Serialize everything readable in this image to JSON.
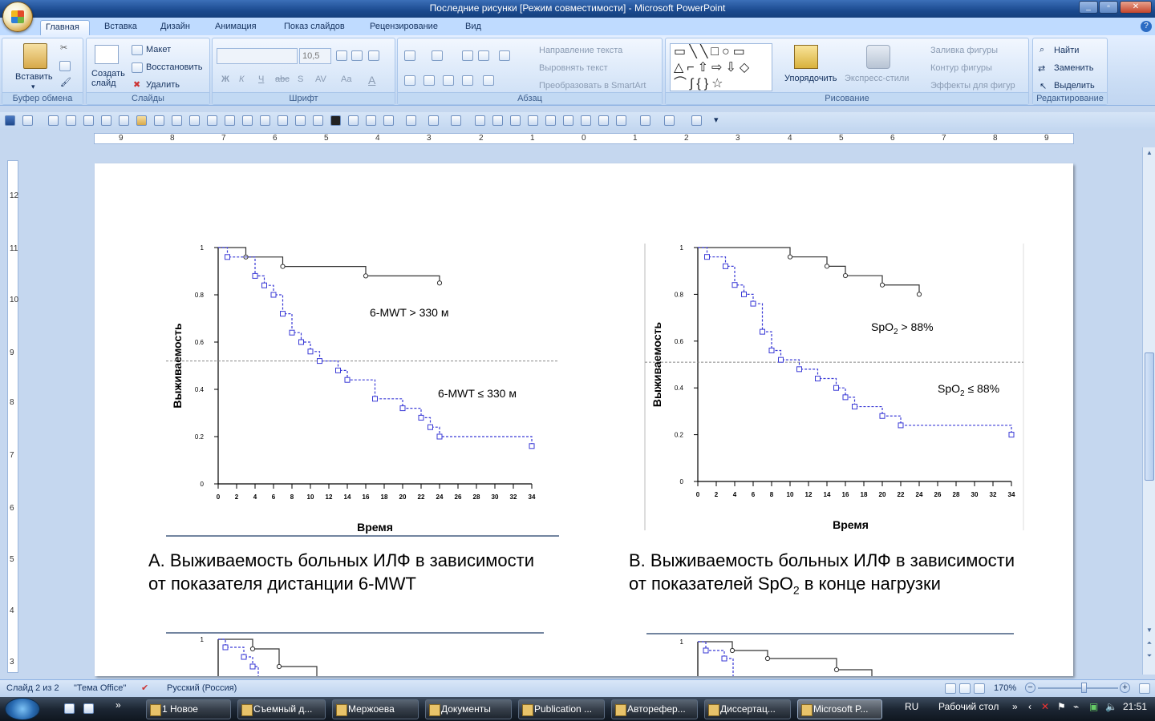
{
  "window": {
    "title": "Последние рисунки [Режим совместимости] - Microsoft PowerPoint"
  },
  "tabs": [
    "Главная",
    "Вставка",
    "Дизайн",
    "Анимация",
    "Показ слайдов",
    "Рецензирование",
    "Вид"
  ],
  "ribbon": {
    "clipboard": {
      "paste": "Вставить",
      "label": "Буфер обмена"
    },
    "slides": {
      "new_slide": "Создать слайд",
      "layout": "Макет",
      "reset": "Восстановить",
      "delete": "Удалить",
      "label": "Слайды"
    },
    "font": {
      "font_size": "10,5",
      "label": "Шрифт",
      "buttons": [
        "Ж",
        "К",
        "Ч",
        "abc",
        "S",
        "AV",
        "Aa",
        "A"
      ]
    },
    "paragraph": {
      "text_direction": "Направление текста",
      "align_text": "Выровнять текст",
      "smartart": "Преобразовать в SmartArt",
      "label": "Абзац"
    },
    "drawing": {
      "arrange": "Упорядочить",
      "quick_styles": "Экспресс-стили",
      "fill": "Заливка фигуры",
      "outline": "Контур фигуры",
      "effects": "Эффекты для фигур",
      "label": "Рисование"
    },
    "editing": {
      "find": "Найти",
      "replace": "Заменить",
      "select": "Выделить",
      "label": "Редактирование"
    }
  },
  "ruler_h": [
    "9",
    "8",
    "7",
    "6",
    "5",
    "4",
    "3",
    "2",
    "1",
    "0",
    "1",
    "2",
    "3",
    "4",
    "5",
    "6",
    "7",
    "8",
    "9"
  ],
  "ruler_v": [
    "12",
    "11",
    "10",
    "9",
    "8",
    "7",
    "6",
    "5",
    "4",
    "3"
  ],
  "slide": {
    "caption_a": [
      "A. Выживаемость больных ИЛФ в зависимости",
      "от показателя дистанции 6-MWT"
    ],
    "caption_b_line1": "B. Выживаемость больных ИЛФ в зависимости",
    "caption_b_line2_pre": "от показателей SpO",
    "caption_b_line2_sub": "2",
    "caption_b_line2_post": " в конце нагрузки"
  },
  "chart_data": [
    {
      "type": "line",
      "step": true,
      "ylabel": "Выживаемость",
      "xlabel": "Время",
      "xlim": [
        0,
        34
      ],
      "ylim": [
        0,
        1
      ],
      "x_ticks": [
        0,
        2,
        4,
        6,
        8,
        10,
        12,
        14,
        16,
        18,
        20,
        22,
        24,
        26,
        28,
        30,
        32,
        34
      ],
      "y_ticks": [
        "0",
        "0.2",
        "0.4",
        "0.6",
        "0.8",
        "1"
      ],
      "reference_line_y": 0.52,
      "series": [
        {
          "name": "6-MWT > 330 м",
          "color": "#333333",
          "style": "solid",
          "marker": "circle",
          "x": [
            0,
            3,
            7,
            16,
            24
          ],
          "y": [
            1,
            0.96,
            0.92,
            0.88,
            0.85
          ]
        },
        {
          "name": "6-MWT ≤ 330 м",
          "color": "#3a3ad6",
          "style": "dashed",
          "marker": "square",
          "x": [
            0,
            1,
            4,
            5,
            6,
            7,
            8,
            9,
            10,
            11,
            13,
            14,
            17,
            20,
            22,
            23,
            24,
            34
          ],
          "y": [
            1,
            0.96,
            0.88,
            0.84,
            0.8,
            0.72,
            0.64,
            0.6,
            0.56,
            0.52,
            0.48,
            0.44,
            0.36,
            0.32,
            0.28,
            0.24,
            0.2,
            0.16
          ]
        }
      ]
    },
    {
      "type": "line",
      "step": true,
      "ylabel": "Выживаемость",
      "xlabel": "Время",
      "xlim": [
        0,
        34
      ],
      "ylim": [
        0,
        1
      ],
      "x_ticks": [
        0,
        2,
        4,
        6,
        8,
        10,
        12,
        14,
        16,
        18,
        20,
        22,
        24,
        26,
        28,
        30,
        32,
        34
      ],
      "y_ticks": [
        "0",
        "0.2",
        "0.4",
        "0.6",
        "0.8",
        "1"
      ],
      "reference_line_y": 0.51,
      "series": [
        {
          "name": "SpO2 > 88%",
          "label_pre": "SpO",
          "label_sub": "2",
          "label_post": " > 88%",
          "color": "#333333",
          "style": "solid",
          "marker": "circle",
          "x": [
            0,
            10,
            14,
            16,
            20,
            24
          ],
          "y": [
            1,
            0.96,
            0.92,
            0.88,
            0.84,
            0.8
          ]
        },
        {
          "name": "SpO2 ≤ 88%",
          "label_pre": "SpO",
          "label_sub": "2",
          "label_post": " ≤ 88%",
          "color": "#3a3ad6",
          "style": "dashed",
          "marker": "square",
          "x": [
            0,
            1,
            3,
            4,
            5,
            6,
            7,
            8,
            9,
            11,
            13,
            15,
            16,
            17,
            20,
            22,
            34
          ],
          "y": [
            1,
            0.96,
            0.92,
            0.84,
            0.8,
            0.76,
            0.64,
            0.56,
            0.52,
            0.48,
            0.44,
            0.4,
            0.36,
            0.32,
            0.28,
            0.24,
            0.2
          ]
        }
      ]
    }
  ],
  "status": {
    "slide": "Слайд 2 из 2",
    "theme": "\"Тема Office\"",
    "language": "Русский (Россия)",
    "zoom": "170%"
  },
  "taskbar": {
    "items": [
      "1 Новое",
      "Съемный д...",
      "Мержоева",
      "Документы",
      "Publication ...",
      "Авторефер...",
      "Диссертац...",
      "Microsoft P..."
    ],
    "lang": "RU",
    "desktop": "Рабочий стол",
    "time": "21:51"
  }
}
